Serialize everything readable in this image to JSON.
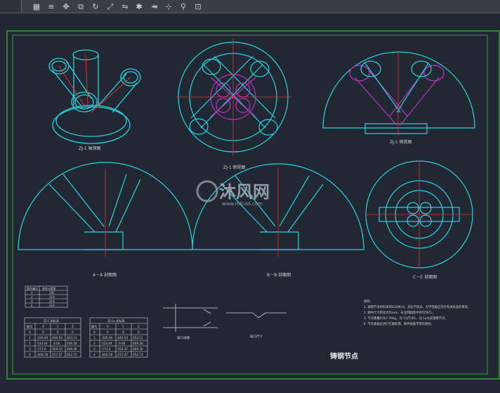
{
  "toolbar": {
    "icons": [
      "select-icon",
      "layer-icon",
      "move-icon",
      "copy-icon",
      "rotate-icon",
      "scale-icon",
      "mirror-icon",
      "trim-icon",
      "extend-icon",
      "fillet-icon",
      "snap-icon",
      "grid-icon",
      "pin-icon",
      "lock-icon"
    ]
  },
  "drawing": {
    "title": "铸钢节点",
    "watermark": "沐风网",
    "watermark_url": "www.mfcad.com",
    "views": {
      "v1": "ZJ-1 轴测图",
      "v2": "ZJ-1 俯视图",
      "v3": "ZJ-1 侧视图",
      "a": "A－A 剖面图",
      "b": "B－B 剖面图",
      "c": "C－C 剖面图"
    },
    "table_small": {
      "headers": [
        "管件编号",
        "直径×壁厚"
      ],
      "rows": [
        [
          "1",
          "245"
        ],
        [
          "2",
          "219"
        ],
        [
          "3",
          "219"
        ],
        [
          "4",
          "219"
        ]
      ]
    },
    "table_left": {
      "title": "ZJ-1 坐标表",
      "headers": [
        "编号",
        "X",
        "Y",
        "Z"
      ],
      "rows": [
        [
          "0",
          "0",
          "0",
          "0"
        ],
        [
          "1",
          "-226.49",
          "-440.93",
          "653.11"
        ],
        [
          "2",
          "533.04",
          "0.00",
          "609.30"
        ],
        [
          "3",
          "-173.0",
          "-559.37",
          "609.30"
        ],
        [
          "4",
          "-400.78",
          "157.47",
          "652.73"
        ]
      ]
    },
    "table_right": {
      "title": "ZJ-1a 坐标表",
      "headers": [
        "编号",
        "X",
        "Y",
        "Z"
      ],
      "rows": [
        [
          "0",
          "0",
          "0",
          "0"
        ],
        [
          "1",
          "-226.49",
          "-440.53",
          "653.11"
        ],
        [
          "2",
          "533.04",
          "0.00",
          "609.30"
        ],
        [
          "3",
          "-173.0",
          "-559.37",
          "609.30"
        ],
        [
          "4",
          "-400.78",
          "-157.47",
          "652.73"
        ]
      ]
    },
    "notes": [
      "说明:",
      "1. 铸钢节点材料采用G20Mn5，其化学成分、力学性能应符合有关标准的要求。",
      "2. 图中尺寸单位均为mm，未注明圆角半径均为R5。",
      "3. 节点重量约为7.76kg。ZJ-1为节点1，ZJ-1a为其镜像节点。",
      "4. 节点表面应进行打磨处理，铸件表面不得有裂纹。"
    ],
    "detail_labels": [
      "坡口详图",
      "坡口尺寸"
    ]
  }
}
